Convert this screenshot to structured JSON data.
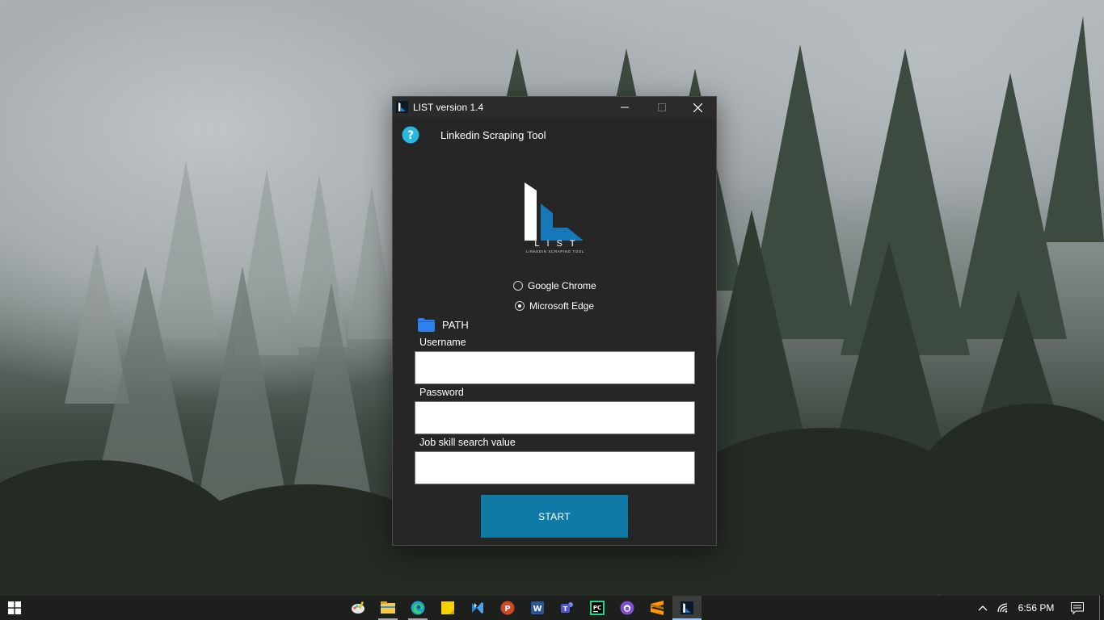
{
  "window": {
    "title": "LIST version 1.4",
    "header_text": "Linkedin Scraping Tool"
  },
  "logo": {
    "word": "LIST",
    "subtitle": "LINKEDIN SCRAPING TOOL"
  },
  "browser_options": [
    {
      "label": "Google Chrome",
      "selected": false
    },
    {
      "label": "Microsoft Edge",
      "selected": true
    }
  ],
  "path": {
    "label": "PATH"
  },
  "form": {
    "username_label": "Username",
    "username_value": "",
    "password_label": "Password",
    "password_value": "",
    "job_label": "Job skill search value",
    "job_value": "",
    "start_label": "START"
  },
  "colors": {
    "window_bg": "#262626",
    "accent": "#0e7aa5",
    "help_icon": "#27b7e0",
    "folder_icon": "#2f80ed"
  },
  "taskbar": {
    "apps": [
      {
        "name": "paint-icon",
        "running": false
      },
      {
        "name": "file-explorer-icon",
        "running": true
      },
      {
        "name": "edge-icon",
        "running": true
      },
      {
        "name": "sticky-notes-icon",
        "running": false
      },
      {
        "name": "visual-studio-icon",
        "running": false
      },
      {
        "name": "powerpoint-icon",
        "running": false
      },
      {
        "name": "word-icon",
        "running": false
      },
      {
        "name": "teams-icon",
        "running": false
      },
      {
        "name": "pycharm-icon",
        "running": false
      },
      {
        "name": "github-desktop-icon",
        "running": false
      },
      {
        "name": "sublime-text-icon",
        "running": false
      },
      {
        "name": "list-app-icon",
        "running": true,
        "active": true
      }
    ],
    "clock": "6:56 PM"
  }
}
